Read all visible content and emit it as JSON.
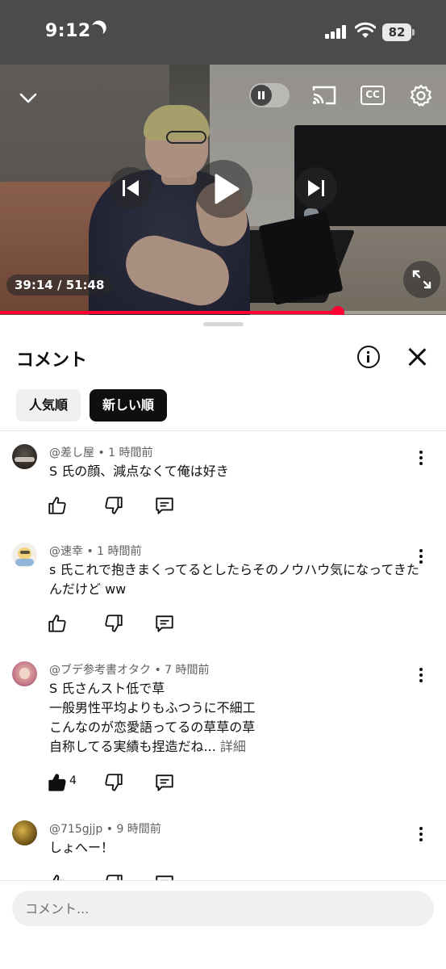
{
  "status_bar": {
    "time": "9:12",
    "battery": "82"
  },
  "player": {
    "time_current": "39:14",
    "time_separator": " / ",
    "time_total": "51:48",
    "progress_fraction": 0.757,
    "cc_label": "CC",
    "accent_color": "#ff0033"
  },
  "comments_panel": {
    "title": "コメント",
    "sort_chips": [
      {
        "label": "人気順",
        "selected": false
      },
      {
        "label": "新しい順",
        "selected": true
      }
    ],
    "comments": [
      {
        "author": "@差し屋",
        "time": "1 時間前",
        "text": "S 氏の顔、減点なくて俺は好き",
        "likes": "",
        "avatar_icon": "avatar-dark-icon"
      },
      {
        "author": "@速幸",
        "time": "1 時間前",
        "text": "s 氏これで抱きまくってるとしたらそのノウハウ気になってきたんだけど ww",
        "likes": "",
        "avatar_icon": "avatar-character-icon"
      },
      {
        "author": "@ブデ参考書オタク",
        "time": "7 時間前",
        "text": "S 氏さんスト低で草\n一般男性平均よりもふつうに不細工\nこんなのが恋愛語ってるの草草の草\n自称してる実績も捏造だね...",
        "more_label": "詳細",
        "likes": "4",
        "avatar_icon": "avatar-photo-icon"
      },
      {
        "author": "@715gjjp",
        "time": "9 時間前",
        "text": "しょへー！",
        "likes": "",
        "avatar_icon": "avatar-gold-icon"
      }
    ],
    "meta_separator": " • ",
    "input_placeholder": "コメント..."
  }
}
